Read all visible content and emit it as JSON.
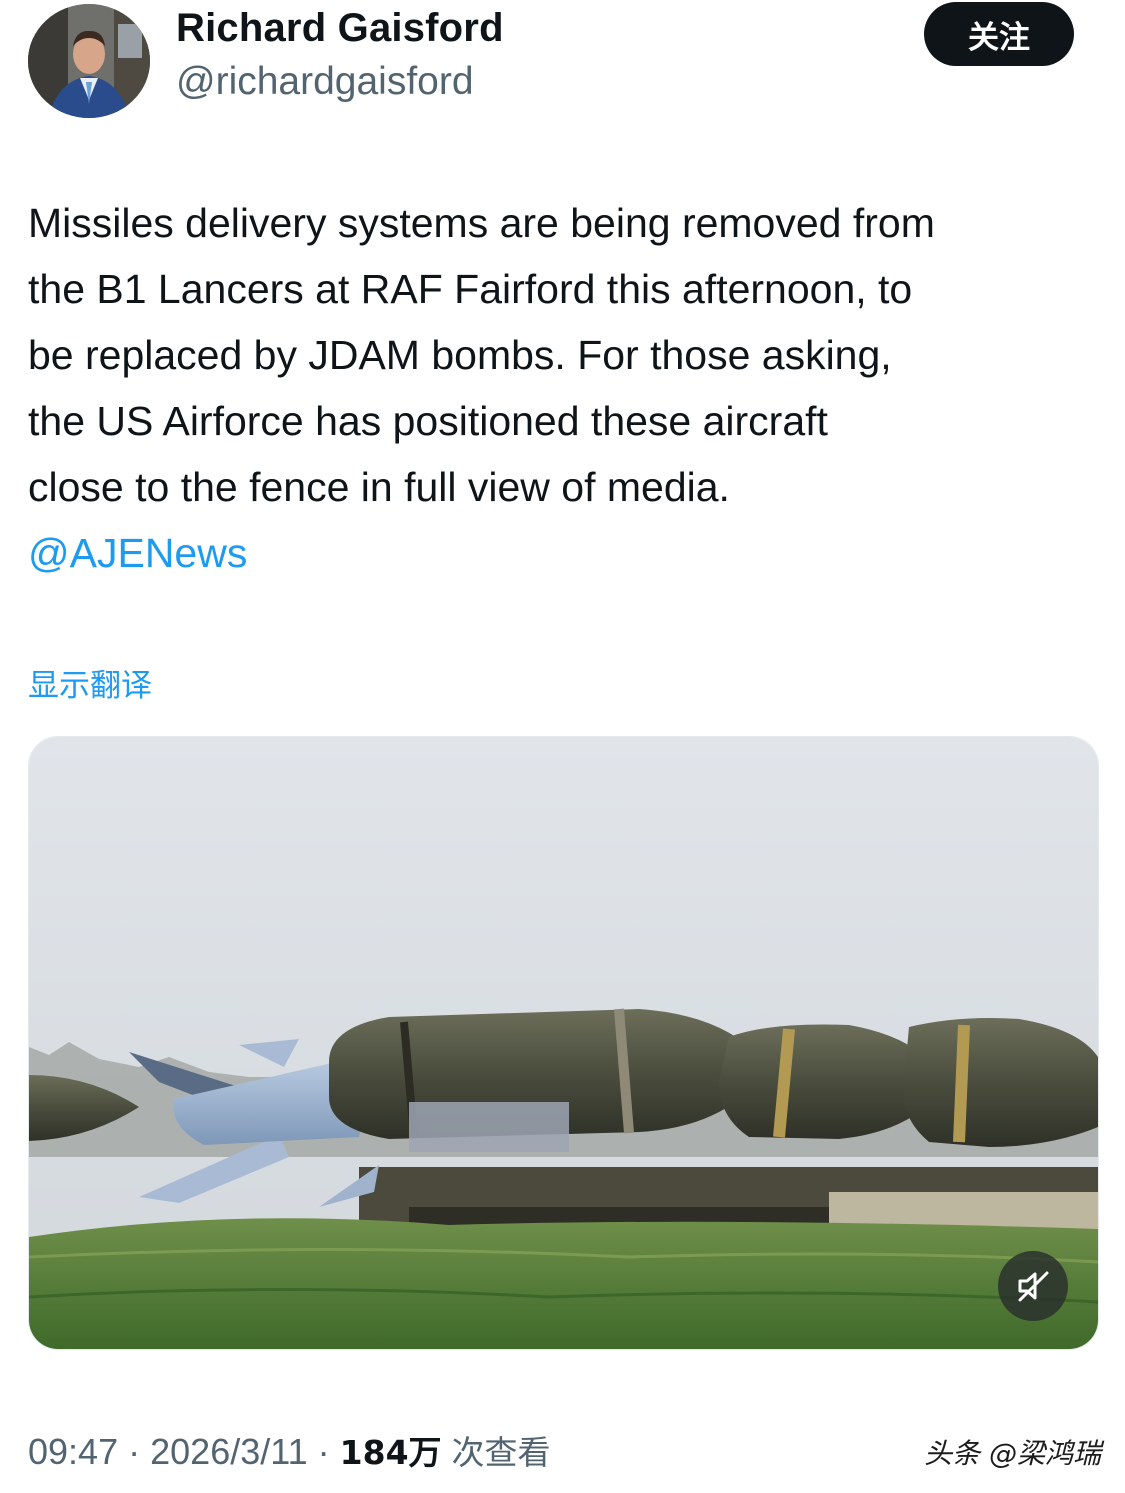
{
  "author": {
    "display_name": "Richard Gaisford",
    "handle": "@richardgaisford"
  },
  "follow_button": {
    "label": "关注"
  },
  "tweet": {
    "lines": [
      "Missiles delivery systems are being removed from",
      "the B1 Lancers at RAF Fairford this afternoon, to",
      "be replaced by JDAM bombs. For those asking,",
      "the US Airforce has positioned these aircraft",
      "close to the fence in full view of media."
    ],
    "mention": "@AJENews"
  },
  "translate_link": "显示翻译",
  "media": {
    "mute_icon": "speaker-muted-icon"
  },
  "footer": {
    "time": "09:47",
    "separator": "·",
    "date": "2026/3/11",
    "views_count": "184万",
    "views_label": "次查看"
  },
  "watermark": "头条 @梁鸿瑞",
  "colors": {
    "link": "#1d9bf0",
    "text": "#0f1419",
    "secondary": "#536471",
    "button_bg": "#0f1419"
  }
}
